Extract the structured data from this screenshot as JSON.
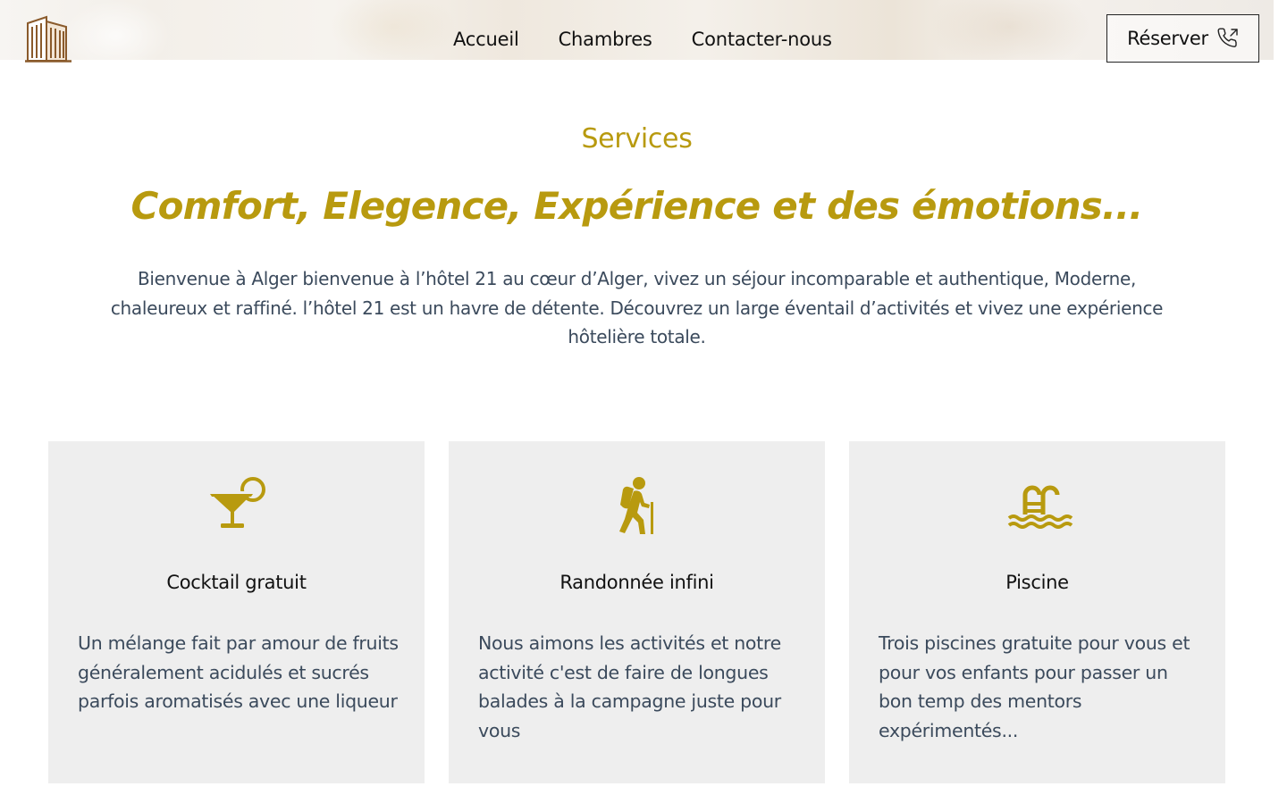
{
  "header": {
    "nav": [
      "Accueil",
      "Chambres",
      "Contacter-nous"
    ],
    "reserve_label": "Réserver",
    "logo_icon": "hotel-building-icon",
    "reserve_icon": "phone-outgoing-icon"
  },
  "intro": {
    "eyebrow": "Services",
    "headline": "Comfort, Elegence, Expérience et des émotions...",
    "body": "Bienvenue à Alger bienvenue à l’hôtel 21 au cœur d’Alger, vivez un séjour incomparable et authentique, Moderne, chaleureux et raffiné. l’hôtel 21 est un havre de détente. Découvrez un large éventail d’activités et vivez une expérience hôtelière totale."
  },
  "services": [
    {
      "icon": "cocktail-icon",
      "title": "Cocktail gratuit",
      "description": "Un mélange fait par amour de fruits généralement acidulés et sucrés parfois aromatisés avec une liqueur"
    },
    {
      "icon": "hiking-icon",
      "title": "Randonnée infini",
      "description": "Nous aimons les activités et notre activité c'est de faire de longues balades à la campagne juste pour vous"
    },
    {
      "icon": "swimming-pool-icon",
      "title": "Piscine",
      "description": "Trois piscines gratuite pour vous et pour vos enfants pour passer un bon temp des mentors expérimentés..."
    }
  ],
  "colors": {
    "accent": "#b89a0f",
    "logo_brown": "#8a5a2b",
    "card_bg": "#eeeeee",
    "body_text": "#3b4a5c"
  }
}
